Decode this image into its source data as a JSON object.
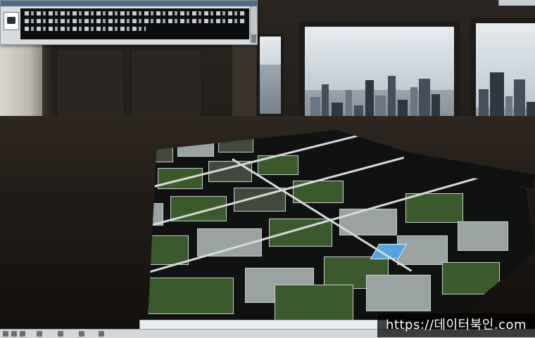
{
  "scene": {
    "description_tag": "architectural model table in office",
    "colors": {
      "sky": "#c3ccd4",
      "floor": "#1e1915",
      "lawn": "#3b5a2c",
      "pool": "#54a6da",
      "window_title": "#4f6a8a"
    }
  },
  "app_window": {
    "icon": "app-icon",
    "lines": 4
  },
  "watermark": {
    "text": "https://데이터북인.com"
  }
}
